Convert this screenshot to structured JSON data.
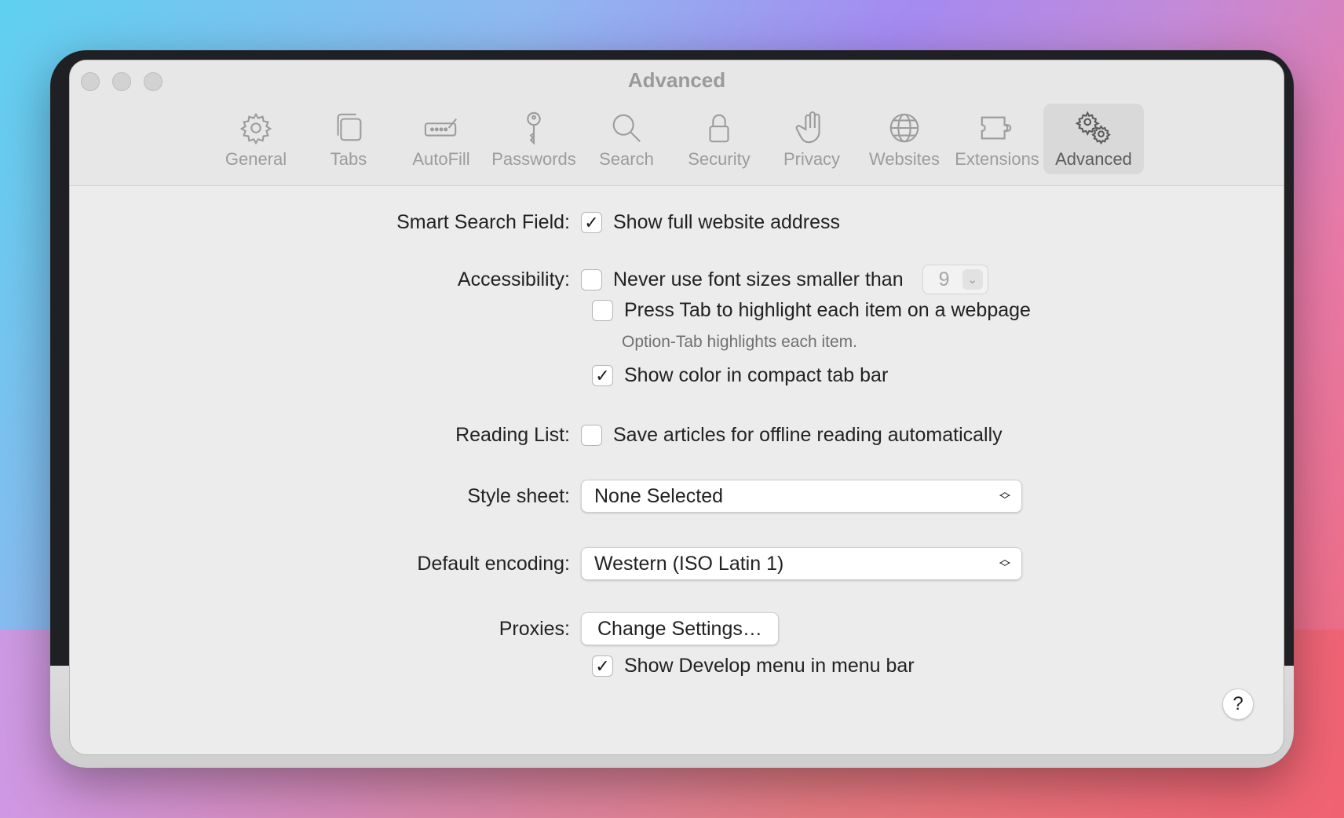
{
  "window": {
    "title": "Advanced"
  },
  "toolbar": {
    "tabs": [
      {
        "label": "General",
        "icon": "gear-icon"
      },
      {
        "label": "Tabs",
        "icon": "tabs-icon"
      },
      {
        "label": "AutoFill",
        "icon": "autofill-icon"
      },
      {
        "label": "Passwords",
        "icon": "key-icon"
      },
      {
        "label": "Search",
        "icon": "search-icon"
      },
      {
        "label": "Security",
        "icon": "lock-icon"
      },
      {
        "label": "Privacy",
        "icon": "hand-icon"
      },
      {
        "label": "Websites",
        "icon": "globe-icon"
      },
      {
        "label": "Extensions",
        "icon": "puzzle-icon"
      },
      {
        "label": "Advanced",
        "icon": "gears-icon",
        "active": true
      }
    ]
  },
  "settings": {
    "smart_search": {
      "label": "Smart Search Field:",
      "option": "Show full website address",
      "checked": true
    },
    "accessibility": {
      "label": "Accessibility:",
      "font_size_option": "Never use font sizes smaller than",
      "font_size_value": "9",
      "font_size_checked": false,
      "tab_option": "Press Tab to highlight each item on a webpage",
      "tab_checked": false,
      "tab_hint": "Option-Tab highlights each item.",
      "color_option": "Show color in compact tab bar",
      "color_checked": true
    },
    "reading_list": {
      "label": "Reading List:",
      "option": "Save articles for offline reading automatically",
      "checked": false
    },
    "style_sheet": {
      "label": "Style sheet:",
      "value": "None Selected"
    },
    "encoding": {
      "label": "Default encoding:",
      "value": "Western (ISO Latin 1)"
    },
    "proxies": {
      "label": "Proxies:",
      "button": "Change Settings…"
    },
    "develop": {
      "option": "Show Develop menu in menu bar",
      "checked": true
    }
  },
  "help": {
    "label": "?"
  }
}
